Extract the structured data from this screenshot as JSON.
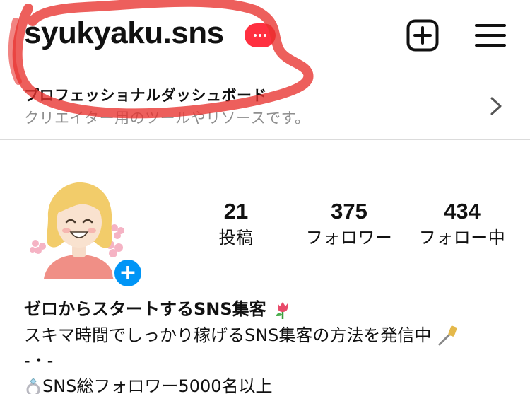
{
  "header": {
    "username": "syukyaku.sns",
    "notif_icon": "ellipsis-badge-icon",
    "add_icon": "plus-square-icon",
    "menu_icon": "hamburger-menu-icon"
  },
  "dashboard": {
    "title": "プロフェッショナルダッシュボード",
    "subtitle": "クリエイター用のツールやリソースです。",
    "chevron_icon": "chevron-right-icon"
  },
  "profile": {
    "avatar_icon": "illustrated-woman-avatar",
    "add_story_icon": "plus-circle-icon",
    "stats": [
      {
        "value": "21",
        "label": "投稿"
      },
      {
        "value": "375",
        "label": "フォロワー"
      },
      {
        "value": "434",
        "label": "フォロー中"
      }
    ]
  },
  "bio": {
    "name": "ゼロからスタートするSNS集客",
    "name_emoji_icon": "tulip-icon",
    "line1": "スキマ時間でしっかり稼げるSNS集客の方法を発信中",
    "line1_emoji_icon": "selfie-stick-icon",
    "line2": "-・-",
    "line3": "SNS総フォロワー5000名以上",
    "line3_emoji_icon": "ring-icon"
  },
  "colors": {
    "accent_blue": "#0095f6",
    "badge_red": "#ff3040",
    "divider": "#dbdbdb",
    "muted_text": "#8e8e8e",
    "doodle_red": "#e8322e"
  }
}
